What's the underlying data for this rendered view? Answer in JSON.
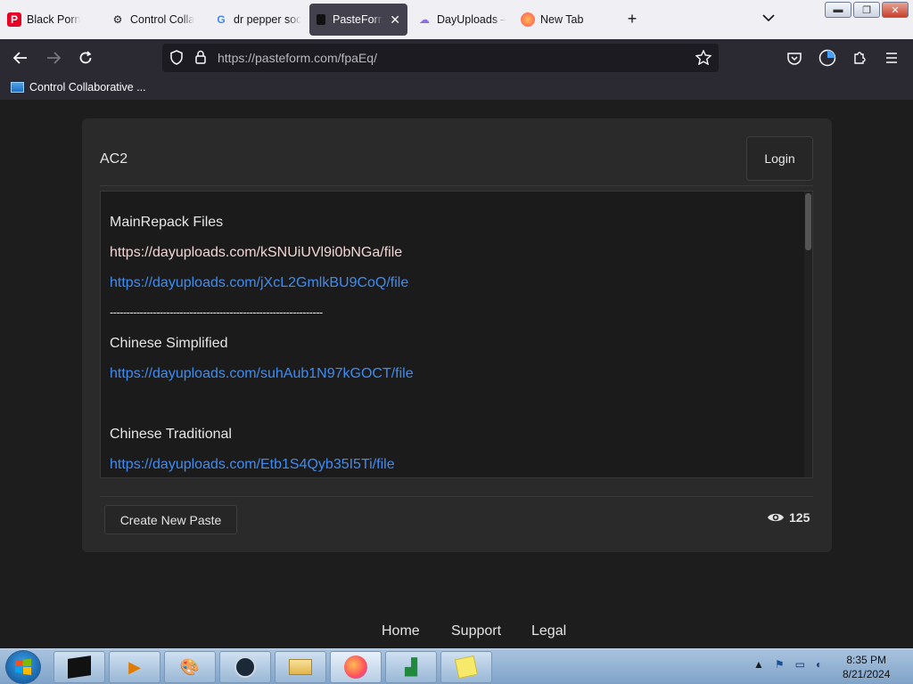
{
  "browser": {
    "tabs": [
      {
        "title": "Black Porn",
        "favicon": "pinterest-icon",
        "active": false
      },
      {
        "title": "Control Colla",
        "favicon": "controller-icon",
        "active": false
      },
      {
        "title": "dr pepper soc",
        "favicon": "google-icon",
        "active": false
      },
      {
        "title": "PasteForm",
        "favicon": "pasteform-icon",
        "active": true
      },
      {
        "title": "DayUploads –",
        "favicon": "dayuploads-icon",
        "active": false
      },
      {
        "title": "New Tab",
        "favicon": "firefox-icon",
        "active": false
      }
    ],
    "url": "https://pasteform.com/fpaEq/",
    "bookmarks": [
      {
        "label": "Control Collaborative ..."
      }
    ]
  },
  "paste": {
    "title": "AC2",
    "login_label": "Login",
    "lines": [
      {
        "text": "MainRepack Files",
        "kind": "text"
      },
      {
        "text": "https://dayuploads.com/kSNUiUVl9i0bNGa/file",
        "kind": "link-visited"
      },
      {
        "text": "https://dayuploads.com/jXcL2GmlkBU9CoQ/file",
        "kind": "link"
      },
      {
        "text": "----------------------------------------------------------------",
        "kind": "text"
      },
      {
        "text": "Chinese Simplified",
        "kind": "text"
      },
      {
        "text": "https://dayuploads.com/suhAub1N97kGOCT/file",
        "kind": "link"
      },
      {
        "text": "Chinese Traditional",
        "kind": "text"
      },
      {
        "text": "https://dayuploads.com/Etb1S4Qyb35I5Ti/file",
        "kind": "link"
      }
    ],
    "create_label": "Create New Paste",
    "views": "125"
  },
  "footer": {
    "links": [
      "Home",
      "Support",
      "Legal"
    ]
  },
  "taskbar": {
    "time": "8:35 PM",
    "date": "8/21/2024"
  },
  "colors": {
    "link": "#3f8cf0",
    "link_visited": "#f2d6d6",
    "card_bg": "#2a2a2a",
    "page_bg": "#1d1d1d"
  }
}
